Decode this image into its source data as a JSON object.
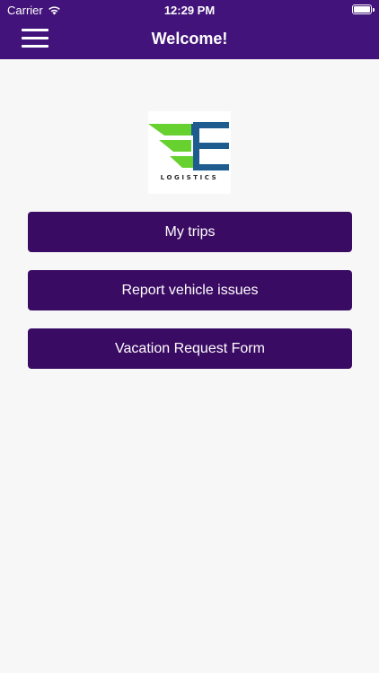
{
  "status_bar": {
    "carrier": "Carrier",
    "time": "12:29 PM",
    "wifi_icon": "wifi-icon",
    "battery_icon": "battery-icon",
    "battery_level": 1.0
  },
  "navbar": {
    "title": "Welcome!",
    "menu_icon": "hamburger-menu-icon",
    "background_color": "#42137a"
  },
  "logo": {
    "text": "LOGISTICS",
    "colors": {
      "green": "#66d12f",
      "blue": "#1e5c8f"
    }
  },
  "actions": [
    {
      "label": "My trips"
    },
    {
      "label": "Report vehicle issues"
    },
    {
      "label": "Vacation Request Form"
    }
  ],
  "colors": {
    "button": "#3a0b63",
    "page_background": "#f7f7f7"
  }
}
